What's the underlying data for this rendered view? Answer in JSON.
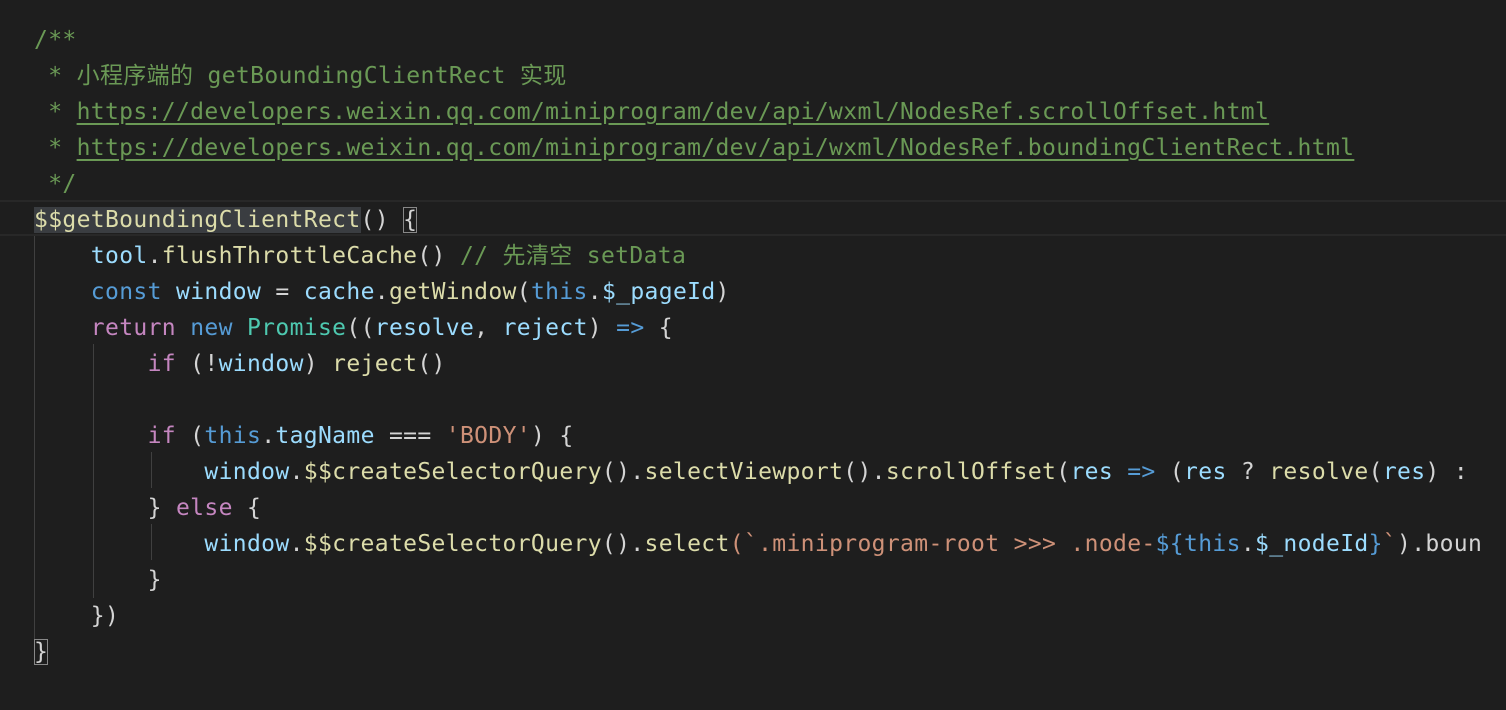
{
  "editor": {
    "colors": {
      "background": "#1e1e1e",
      "comment": "#6a9955",
      "function": "#dcdcaa",
      "variable": "#9cdcfe",
      "keyword": "#569cd6",
      "control": "#c586c0",
      "string": "#ce9178",
      "type": "#4ec9b0",
      "text": "#d4d4d4"
    },
    "lines": [
      {
        "tokens": [
          {
            "text": "/**",
            "c": "comment"
          }
        ]
      },
      {
        "tokens": [
          {
            "text": " * 小程序端的 getBoundingClientRect 实现",
            "c": "comment"
          }
        ]
      },
      {
        "tokens": [
          {
            "text": " * ",
            "c": "comment"
          },
          {
            "text": "https://developers.weixin.qq.com/miniprogram/dev/api/wxml/NodesRef.scrollOffset.html",
            "c": "link"
          }
        ]
      },
      {
        "tokens": [
          {
            "text": " * ",
            "c": "comment"
          },
          {
            "text": "https://developers.weixin.qq.com/miniprogram/dev/api/wxml/NodesRef.boundingClientRect.html",
            "c": "link"
          }
        ]
      },
      {
        "tokens": [
          {
            "text": " */",
            "c": "comment"
          }
        ]
      },
      {
        "tokens": [
          {
            "text": "$$getBoundingClientRect",
            "c": "func",
            "sel": true
          },
          {
            "text": "() ",
            "c": "punc"
          },
          {
            "text": "{",
            "c": "punc",
            "match": true
          }
        ]
      },
      {
        "tokens": [
          {
            "text": "    ",
            "c": "punc"
          },
          {
            "text": "tool",
            "c": "var"
          },
          {
            "text": ".",
            "c": "punc"
          },
          {
            "text": "flushThrottleCache",
            "c": "func"
          },
          {
            "text": "() ",
            "c": "punc"
          },
          {
            "text": "// 先清空 setData",
            "c": "comment"
          }
        ]
      },
      {
        "tokens": [
          {
            "text": "    ",
            "c": "punc"
          },
          {
            "text": "const",
            "c": "kw"
          },
          {
            "text": " ",
            "c": "punc"
          },
          {
            "text": "window",
            "c": "var"
          },
          {
            "text": " = ",
            "c": "punc"
          },
          {
            "text": "cache",
            "c": "var"
          },
          {
            "text": ".",
            "c": "punc"
          },
          {
            "text": "getWindow",
            "c": "func"
          },
          {
            "text": "(",
            "c": "punc"
          },
          {
            "text": "this",
            "c": "kw"
          },
          {
            "text": ".",
            "c": "punc"
          },
          {
            "text": "$_pageId",
            "c": "var"
          },
          {
            "text": ")",
            "c": "punc"
          }
        ]
      },
      {
        "tokens": [
          {
            "text": "    ",
            "c": "punc"
          },
          {
            "text": "return",
            "c": "ctrl"
          },
          {
            "text": " ",
            "c": "punc"
          },
          {
            "text": "new",
            "c": "kw"
          },
          {
            "text": " ",
            "c": "punc"
          },
          {
            "text": "Promise",
            "c": "type"
          },
          {
            "text": "((",
            "c": "punc"
          },
          {
            "text": "resolve",
            "c": "var"
          },
          {
            "text": ", ",
            "c": "punc"
          },
          {
            "text": "reject",
            "c": "var"
          },
          {
            "text": ") ",
            "c": "punc"
          },
          {
            "text": "=>",
            "c": "kw"
          },
          {
            "text": " {",
            "c": "punc"
          }
        ]
      },
      {
        "tokens": [
          {
            "text": "        ",
            "c": "punc"
          },
          {
            "text": "if",
            "c": "ctrl"
          },
          {
            "text": " (!",
            "c": "punc"
          },
          {
            "text": "window",
            "c": "var"
          },
          {
            "text": ") ",
            "c": "punc"
          },
          {
            "text": "reject",
            "c": "func"
          },
          {
            "text": "()",
            "c": "punc"
          }
        ]
      },
      {
        "tokens": [
          {
            "text": "",
            "c": "punc"
          }
        ]
      },
      {
        "tokens": [
          {
            "text": "        ",
            "c": "punc"
          },
          {
            "text": "if",
            "c": "ctrl"
          },
          {
            "text": " (",
            "c": "punc"
          },
          {
            "text": "this",
            "c": "kw"
          },
          {
            "text": ".",
            "c": "punc"
          },
          {
            "text": "tagName",
            "c": "var"
          },
          {
            "text": " === ",
            "c": "punc"
          },
          {
            "text": "'BODY'",
            "c": "str"
          },
          {
            "text": ") {",
            "c": "punc"
          }
        ]
      },
      {
        "tokens": [
          {
            "text": "            ",
            "c": "punc"
          },
          {
            "text": "window",
            "c": "var"
          },
          {
            "text": ".",
            "c": "punc"
          },
          {
            "text": "$$createSelectorQuery",
            "c": "func"
          },
          {
            "text": "().",
            "c": "punc"
          },
          {
            "text": "selectViewport",
            "c": "func"
          },
          {
            "text": "().",
            "c": "punc"
          },
          {
            "text": "scrollOffset",
            "c": "func"
          },
          {
            "text": "(",
            "c": "punc"
          },
          {
            "text": "res",
            "c": "var"
          },
          {
            "text": " ",
            "c": "punc"
          },
          {
            "text": "=>",
            "c": "kw"
          },
          {
            "text": " (",
            "c": "punc"
          },
          {
            "text": "res",
            "c": "var"
          },
          {
            "text": " ? ",
            "c": "punc"
          },
          {
            "text": "resolve",
            "c": "func"
          },
          {
            "text": "(",
            "c": "punc"
          },
          {
            "text": "res",
            "c": "var"
          },
          {
            "text": ") : ",
            "c": "punc"
          }
        ]
      },
      {
        "tokens": [
          {
            "text": "        ",
            "c": "punc"
          },
          {
            "text": "}",
            "c": "punc"
          },
          {
            "text": " ",
            "c": "punc"
          },
          {
            "text": "else",
            "c": "ctrl"
          },
          {
            "text": " {",
            "c": "punc"
          }
        ]
      },
      {
        "tokens": [
          {
            "text": "            ",
            "c": "punc"
          },
          {
            "text": "window",
            "c": "var"
          },
          {
            "text": ".",
            "c": "punc"
          },
          {
            "text": "$$createSelectorQuery",
            "c": "func"
          },
          {
            "text": "().",
            "c": "punc"
          },
          {
            "text": "select",
            "c": "func"
          },
          {
            "text": "(`.miniprogram-root >>> .node-",
            "c": "str"
          },
          {
            "text": "${",
            "c": "kw"
          },
          {
            "text": "this",
            "c": "kw"
          },
          {
            "text": ".",
            "c": "punc"
          },
          {
            "text": "$_nodeId",
            "c": "var"
          },
          {
            "text": "}",
            "c": "kw"
          },
          {
            "text": "`",
            "c": "str"
          },
          {
            "text": ").boun",
            "c": "punc"
          }
        ]
      },
      {
        "tokens": [
          {
            "text": "        ",
            "c": "punc"
          },
          {
            "text": "}",
            "c": "punc"
          }
        ]
      },
      {
        "tokens": [
          {
            "text": "    ",
            "c": "punc"
          },
          {
            "text": "})",
            "c": "punc"
          }
        ]
      },
      {
        "tokens": [
          {
            "text": "}",
            "c": "punc",
            "match": true
          }
        ]
      }
    ]
  }
}
